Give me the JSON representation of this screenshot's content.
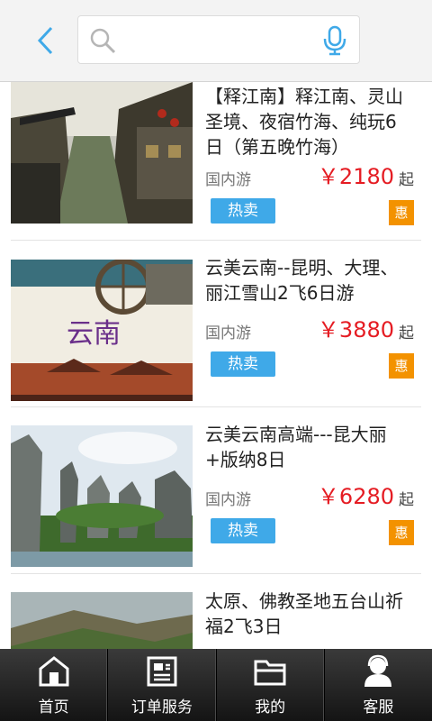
{
  "header": {
    "back_icon": "chevron-left-icon",
    "search": {
      "placeholder": "",
      "value": ""
    },
    "mic_icon": "microphone-icon",
    "accent_color": "#3fa9e8"
  },
  "products": [
    {
      "title": "【释江南】释江南、灵山圣境、夜宿竹海、纯玩6日（第五晚竹海）",
      "category": "国内游",
      "price": "￥2180",
      "suffix": "起",
      "tag": "热卖",
      "badge": "惠"
    },
    {
      "title": "云美云南--昆明、大理、丽江雪山2飞6日游",
      "category": "国内游",
      "price": "￥3880",
      "suffix": "起",
      "tag": "热卖",
      "badge": "惠",
      "image_text": "云南"
    },
    {
      "title": "云美云南高端---昆大丽+版纳8日",
      "category": "国内游",
      "price": "￥6280",
      "suffix": "起",
      "tag": "热卖",
      "badge": "惠"
    },
    {
      "title": "太原、佛教圣地五台山祈福2飞3日"
    }
  ],
  "tabbar": [
    {
      "label": "首页",
      "icon": "home-icon"
    },
    {
      "label": "订单服务",
      "icon": "order-icon"
    },
    {
      "label": "我的",
      "icon": "folder-icon"
    },
    {
      "label": "客服",
      "icon": "customer-service-icon"
    }
  ],
  "colors": {
    "price": "#e51c23",
    "hot_tag": "#3fa9e8",
    "discount_badge": "#f39200"
  }
}
